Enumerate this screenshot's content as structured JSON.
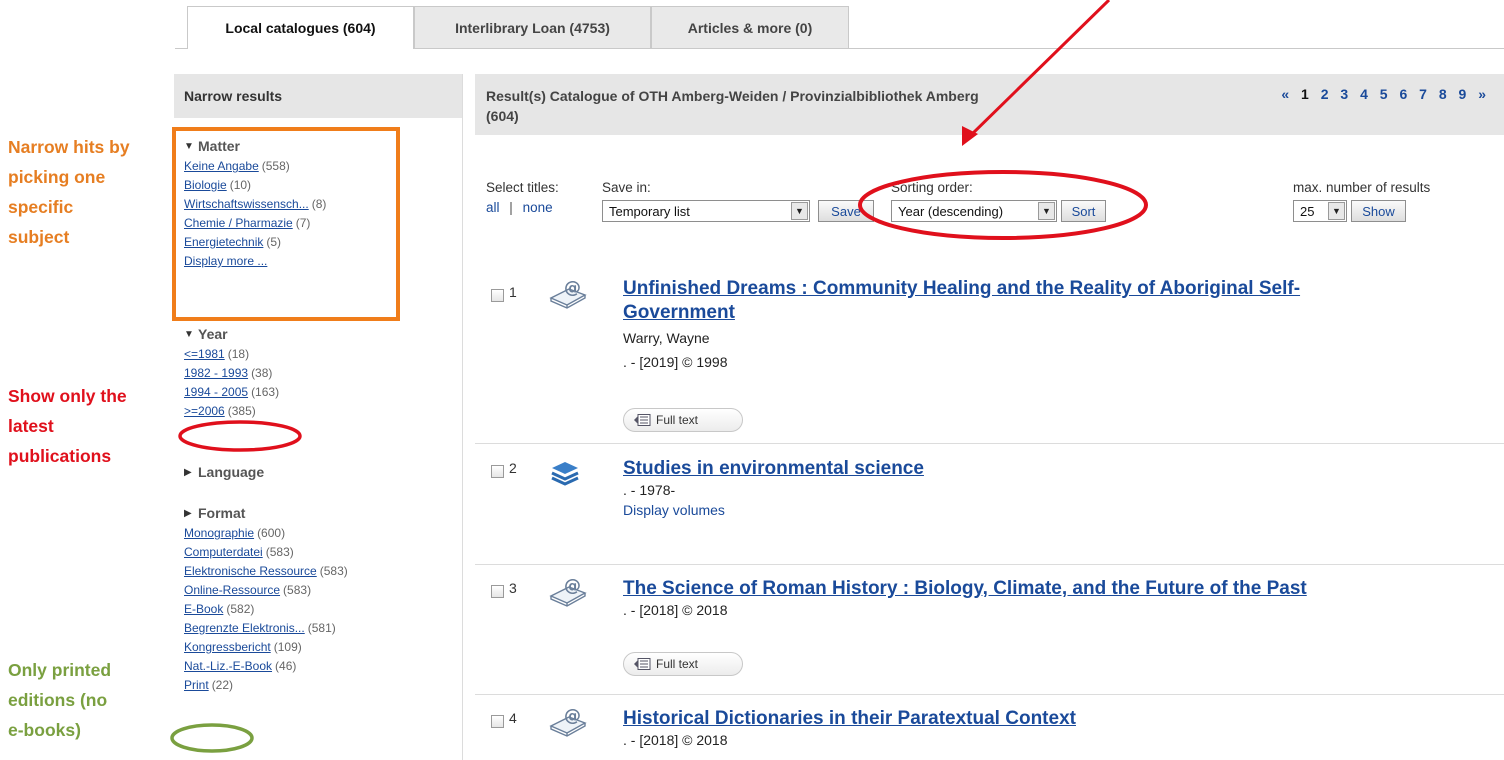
{
  "tabs": [
    {
      "label": "Local catalogues (604)",
      "active": true
    },
    {
      "label": "Interlibrary Loan (4753)",
      "active": false
    },
    {
      "label": "Articles & more (0)",
      "active": false
    }
  ],
  "sidebar": {
    "header": "Narrow results",
    "matter": {
      "title": "Matter",
      "items": [
        {
          "label": "Keine Angabe",
          "count": "(558)"
        },
        {
          "label": "Biologie",
          "count": "(10)"
        },
        {
          "label": "Wirtschaftswissensch...",
          "count": "(8)"
        },
        {
          "label": "Chemie / Pharmazie",
          "count": "(7)"
        },
        {
          "label": "Energietechnik",
          "count": "(5)"
        }
      ],
      "more": "Display more ..."
    },
    "year": {
      "title": "Year",
      "items": [
        {
          "label": "<=1981",
          "count": "(18)"
        },
        {
          "label": "1982 - 1993",
          "count": "(38)"
        },
        {
          "label": "1994 - 2005",
          "count": "(163)"
        },
        {
          "label": ">=2006",
          "count": "(385)"
        }
      ]
    },
    "language": {
      "title": "Language"
    },
    "format": {
      "title": "Format",
      "items": [
        {
          "label": "Monographie",
          "count": "(600)"
        },
        {
          "label": "Computerdatei",
          "count": "(583)"
        },
        {
          "label": "Elektronische Ressource",
          "count": "(583)"
        },
        {
          "label": "Online-Ressource",
          "count": "(583)"
        },
        {
          "label": "E-Book",
          "count": "(582)"
        },
        {
          "label": "Begrenzte Elektronis...",
          "count": "(581)"
        },
        {
          "label": "Kongressbericht",
          "count": "(109)"
        },
        {
          "label": "Nat.-Liz.-E-Book",
          "count": "(46)"
        },
        {
          "label": "Print",
          "count": "(22)"
        }
      ]
    }
  },
  "results": {
    "title_line1": "Result(s) Catalogue of OTH Amberg-Weiden / Provinzialbibliothek Amberg",
    "title_line2": "(604)",
    "pager": {
      "prev": "«",
      "current": "1",
      "pages": [
        "2",
        "3",
        "4",
        "5",
        "6",
        "7",
        "8",
        "9"
      ],
      "next": "»"
    }
  },
  "controls": {
    "select_titles": "Select titles:",
    "all": "all",
    "separator": "|",
    "none": "none",
    "save_in_label": "Save in:",
    "save_in_value": "Temporary list",
    "save_button": "Save",
    "sorting_label": "Sorting order:",
    "sorting_value": "Year (descending)",
    "sort_button": "Sort",
    "max_label": "max. number of results",
    "max_value": "25",
    "show_button": "Show"
  },
  "records": [
    {
      "num": "1",
      "title_line1": "Unfinished Dreams : Community Healing and the Reality of Aboriginal Self-",
      "title_line2": "Government",
      "author": "Warry, Wayne",
      "pub": ". - [2019] © 1998",
      "fulltext": "Full text",
      "type_icon": "ebook-icon"
    },
    {
      "num": "2",
      "title_line1": "Studies in environmental science",
      "pub": ". - 1978-",
      "volumes": "Display volumes",
      "type_icon": "series-books-icon"
    },
    {
      "num": "3",
      "title_line1": "The Science of Roman History : Biology, Climate, and the Future of the Past",
      "pub": ". - [2018] © 2018",
      "fulltext": "Full text",
      "type_icon": "ebook-icon"
    },
    {
      "num": "4",
      "title_line1": "Historical Dictionaries in their Paratextual Context",
      "pub": ". - [2018] © 2018",
      "type_icon": "ebook-icon"
    }
  ],
  "annotations": {
    "subject": [
      "Narrow hits by",
      "picking one",
      "specific",
      "subject"
    ],
    "latest": [
      "Show only the",
      "latest",
      "publications"
    ],
    "printed": [
      "Only printed",
      "editions (no",
      "e-books)"
    ],
    "colors": {
      "orange_box": "#f07d1a",
      "red": "#e0101c",
      "green": "#7aa040",
      "link": "#1a4a9a"
    }
  }
}
